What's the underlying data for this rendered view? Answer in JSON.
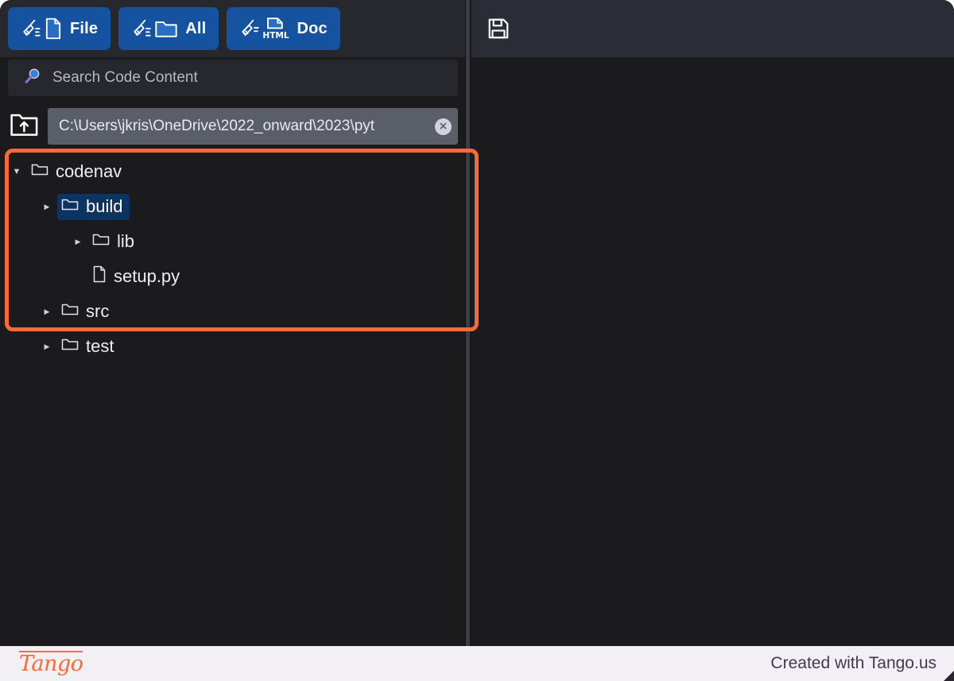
{
  "app": {
    "background_color": "#1b1b1d",
    "accent_color": "#1552a0",
    "highlight_color": "#f96a38",
    "selection_color": "#0d3461"
  },
  "toolbar": {
    "buttons": [
      {
        "label": "File",
        "icon": "broom-file-icon"
      },
      {
        "label": "All",
        "icon": "broom-folder-icon"
      },
      {
        "label": "Doc",
        "icon": "broom-html-doc-icon"
      }
    ]
  },
  "search": {
    "icon": "magnifier-icon",
    "placeholder": "Search Code Content",
    "value": ""
  },
  "path": {
    "open_folder_icon": "folder-upload-icon",
    "value": "C:\\Users\\jkris\\OneDrive\\2022_onward\\2023\\pyt",
    "clear_label": "×"
  },
  "tree": {
    "items": [
      {
        "label": "codenav",
        "type": "folder",
        "depth": 0,
        "caret": "▼",
        "selected": false
      },
      {
        "label": "build",
        "type": "folder",
        "depth": 1,
        "caret": "▶",
        "selected": true
      },
      {
        "label": "lib",
        "type": "folder",
        "depth": 2,
        "caret": "▶",
        "selected": false
      },
      {
        "label": "setup.py",
        "type": "file",
        "depth": 2,
        "caret": "",
        "selected": false
      },
      {
        "label": "src",
        "type": "folder",
        "depth": 1,
        "caret": "▶",
        "selected": false
      },
      {
        "label": "test",
        "type": "folder",
        "depth": 1,
        "caret": "▶",
        "selected": false
      }
    ]
  },
  "editor": {
    "save_icon": "floppy-save-icon",
    "content": ""
  },
  "footer": {
    "logo": "Tango",
    "credit": "Created with Tango.us"
  }
}
